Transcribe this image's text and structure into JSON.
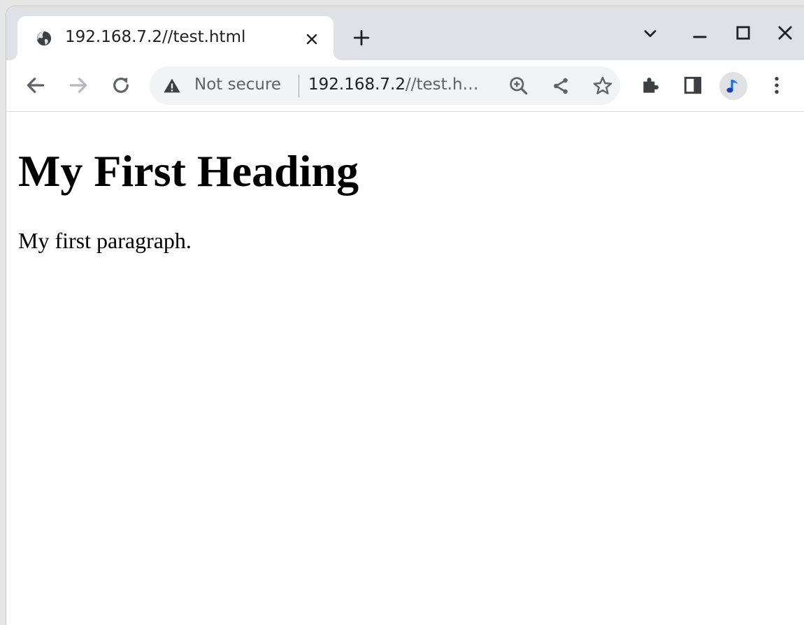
{
  "tab": {
    "title": "192.168.7.2//test.html",
    "favicon": "globe-icon"
  },
  "toolbar": {
    "security_label": "Not secure",
    "url_host": "192.168.7.2",
    "url_path": "//test.h…"
  },
  "page": {
    "heading": "My First Heading",
    "paragraph": "My first paragraph."
  },
  "colors": {
    "tabstrip_bg": "#dee1e6",
    "omnibox_bg": "#f1f3f4",
    "icon": "#5f6368",
    "profile_accent": "#1a73e8"
  }
}
